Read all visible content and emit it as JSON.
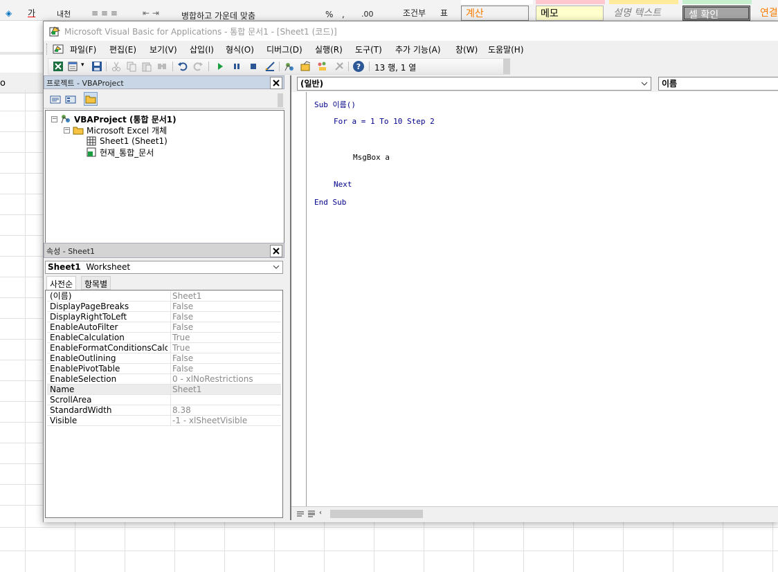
{
  "excel": {
    "ribbon": {
      "font_color_char": "가",
      "wrap_label": "내천",
      "merge_label": "병합하고 가운데 맞춤",
      "percent": "%",
      "comma": ",",
      "decimal_inc": ".00",
      "conditional_label": "조건부",
      "table_label": "표",
      "cell_styles": {
        "calc": "계산",
        "memo": "메모",
        "desc": "설명 텍스트",
        "check": "셀 확인",
        "link": "연결"
      }
    },
    "namebox_fragment": "o"
  },
  "vbe": {
    "title": "Microsoft Visual Basic for Applications - 통합 문서1 - [Sheet1 (코드)]",
    "menu": [
      "파일(F)",
      "편집(E)",
      "보기(V)",
      "삽입(I)",
      "형식(O)",
      "디버그(D)",
      "실행(R)",
      "도구(T)",
      "추가 기능(A)",
      "창(W)",
      "도움말(H)"
    ],
    "toolbar": {
      "position_label": "13 행, 1 열"
    },
    "project": {
      "header": "프로젝트 - VBAProject",
      "tree": {
        "root": "VBAProject (통합 문서1)",
        "folder": "Microsoft Excel 개체",
        "sheet": "Sheet1 (Sheet1)",
        "workbook": "현재_통합_문서"
      }
    },
    "properties": {
      "header": "속성 - Sheet1",
      "object_name": "Sheet1",
      "object_type": "Worksheet",
      "tabs": [
        "사전순",
        "항목별"
      ],
      "rows": [
        {
          "name": "(이름)",
          "value": "Sheet1"
        },
        {
          "name": "DisplayPageBreaks",
          "value": "False"
        },
        {
          "name": "DisplayRightToLeft",
          "value": "False"
        },
        {
          "name": "EnableAutoFilter",
          "value": "False"
        },
        {
          "name": "EnableCalculation",
          "value": "True"
        },
        {
          "name": "EnableFormatConditionsCalcu",
          "value": "True"
        },
        {
          "name": "EnableOutlining",
          "value": "False"
        },
        {
          "name": "EnablePivotTable",
          "value": "False"
        },
        {
          "name": "EnableSelection",
          "value": "0 - xlNoRestrictions"
        },
        {
          "name": "Name",
          "value": "Sheet1"
        },
        {
          "name": "ScrollArea",
          "value": ""
        },
        {
          "name": "StandardWidth",
          "value": "8.38"
        },
        {
          "name": "Visible",
          "value": "-1 - xlSheetVisible"
        }
      ]
    },
    "code": {
      "object_combo": "(일반)",
      "proc_combo": "이름",
      "lines": {
        "l1": "Sub 이름()",
        "l2": "For a = 1 To 10 Step 2",
        "l3": "MsgBox a",
        "l4": "Next",
        "l5": "End Sub"
      }
    }
  }
}
